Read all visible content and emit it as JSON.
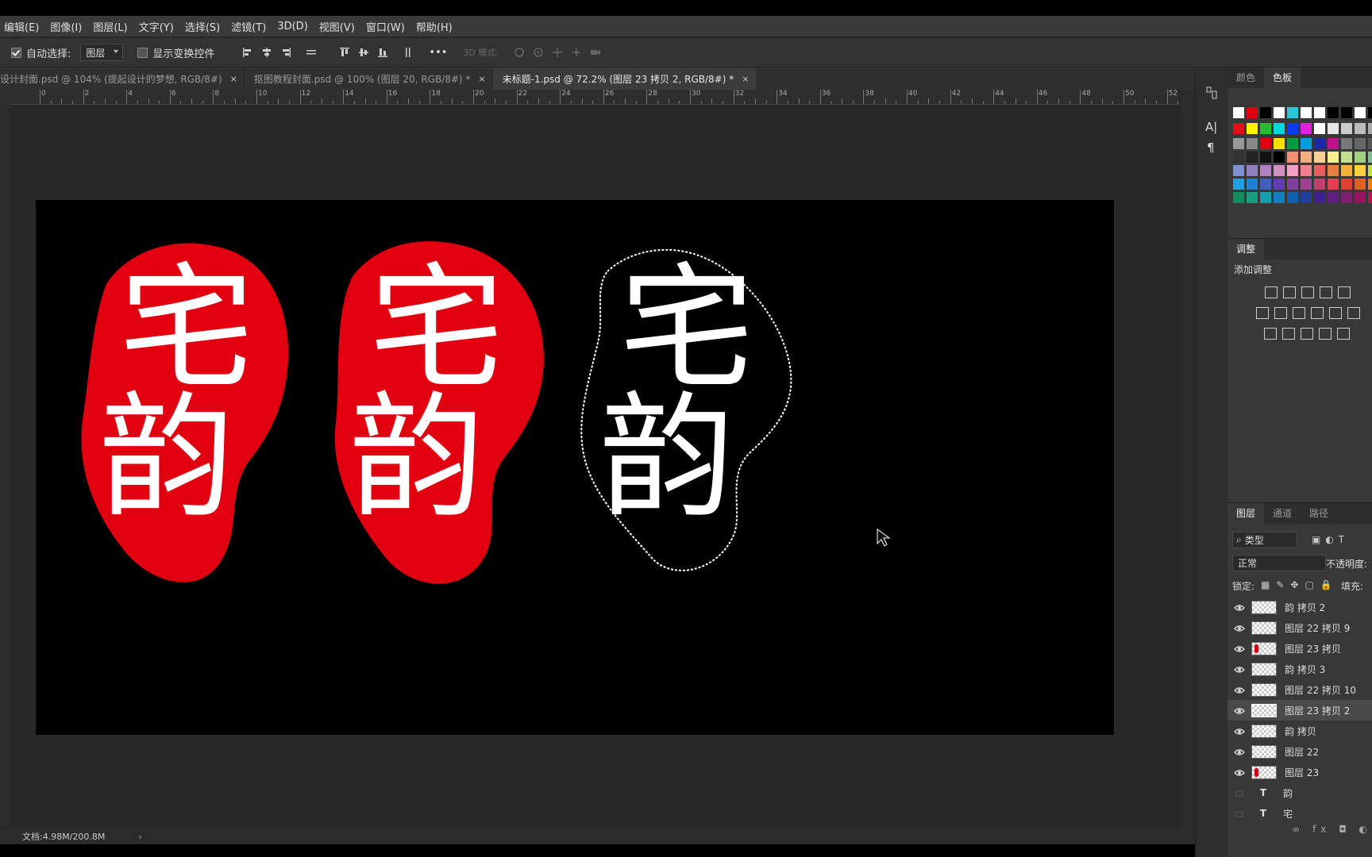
{
  "menu": [
    "编辑(E)",
    "图像(I)",
    "图层(L)",
    "文字(Y)",
    "选择(S)",
    "滤镜(T)",
    "3D(D)",
    "视图(V)",
    "窗口(W)",
    "帮助(H)"
  ],
  "options": {
    "auto_select_label": "自动选择:",
    "auto_select_value": "图层",
    "show_transform_label": "显示变换控件",
    "mode_3d_label": "3D 模式:",
    "more_glyph": "•••"
  },
  "tabs": [
    {
      "label": "设计封面.psd @ 104% (提起设计的梦想, RGB/8#)",
      "close": "×"
    },
    {
      "label": "抠图教程封面.psd @ 100% (图层 20, RGB/8#) *",
      "close": "×"
    },
    {
      "label": "未标题-1.psd @ 72.2% (图层 23 拷贝 2, RGB/8#) *",
      "close": "×"
    }
  ],
  "ruler_ticks": [
    "0",
    "2",
    "4",
    "6",
    "8",
    "10",
    "12",
    "14",
    "16",
    "18",
    "20",
    "22",
    "24",
    "26",
    "28",
    "30",
    "32",
    "34",
    "36",
    "38",
    "40",
    "42",
    "44",
    "46",
    "48",
    "50",
    "52"
  ],
  "canvas": {
    "seal_chars": [
      "宅",
      "韵"
    ],
    "colors": {
      "seal_red": "#e0000f",
      "text_white": "#ffffff",
      "background": "#000000"
    }
  },
  "status": {
    "doc_info": "文档:4.98M/200.8M",
    "arrow": "›"
  },
  "panels": {
    "swatch_tabs": [
      "颜色",
      "色板"
    ],
    "adjust_title": "调整",
    "adjust_add": "添加调整",
    "layer_tabs": [
      "图层",
      "通道",
      "路径"
    ],
    "filter_label": "类型",
    "blend_mode": "正常",
    "opacity_label": "不透明度:",
    "lock_label": "锁定:",
    "fill_label": "填充:"
  },
  "layers": [
    {
      "name": "韵 拷贝 2",
      "kind": "pixel",
      "red": false,
      "selected": false
    },
    {
      "name": "图层 22 拷贝 9",
      "kind": "pixel",
      "red": false,
      "selected": false
    },
    {
      "name": "图层 23 拷贝",
      "kind": "pixel",
      "red": true,
      "selected": false
    },
    {
      "name": "韵 拷贝 3",
      "kind": "pixel",
      "red": false,
      "selected": false
    },
    {
      "name": "图层 22 拷贝 10",
      "kind": "pixel",
      "red": false,
      "selected": false
    },
    {
      "name": "图层 23 拷贝 2",
      "kind": "pixel",
      "red": false,
      "selected": true
    },
    {
      "name": "韵 拷贝",
      "kind": "pixel",
      "red": false,
      "selected": false
    },
    {
      "name": "图层 22",
      "kind": "pixel",
      "red": false,
      "selected": false
    },
    {
      "name": "图层 23",
      "kind": "pixel",
      "red": true,
      "selected": false
    },
    {
      "name": "韵",
      "kind": "text",
      "red": false,
      "selected": false
    },
    {
      "name": "宅",
      "kind": "text",
      "red": false,
      "selected": false
    }
  ]
}
